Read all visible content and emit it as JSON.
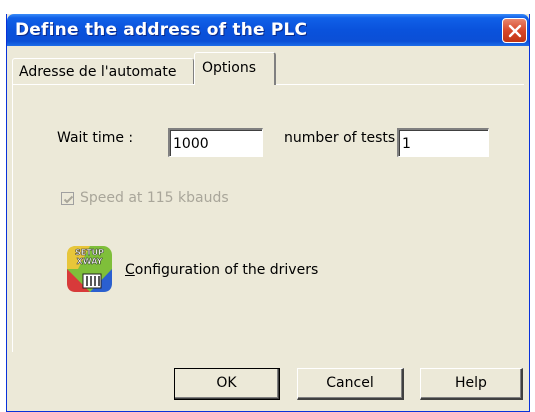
{
  "window": {
    "title": "Define the address of the PLC"
  },
  "tabs": [
    {
      "label": "Adresse de l'automate",
      "active": false
    },
    {
      "label": "Options",
      "active": true
    }
  ],
  "options": {
    "wait_time_label": "Wait time :",
    "wait_time_value": "1000",
    "number_of_tests_label": "number of tests",
    "number_of_tests_value": "1",
    "speed_checkbox_label": "Speed at 115 kbauds",
    "speed_checkbox_checked": true,
    "speed_checkbox_enabled": false,
    "drivers_icon_text": [
      "SETUP",
      "XWAY"
    ],
    "drivers_link_label": "Configuration of the drivers"
  },
  "buttons": {
    "ok": "OK",
    "cancel": "Cancel",
    "help": "Help"
  },
  "colors": {
    "titlebar": "#0a52dc",
    "dialog_bg": "#ece9d8",
    "close_button": "#d8482a",
    "disabled_text": "#a9a69a"
  },
  "icons": {
    "close": "close-icon",
    "checkmark": "checkmark-icon",
    "drivers": "setup-xway-icon"
  }
}
